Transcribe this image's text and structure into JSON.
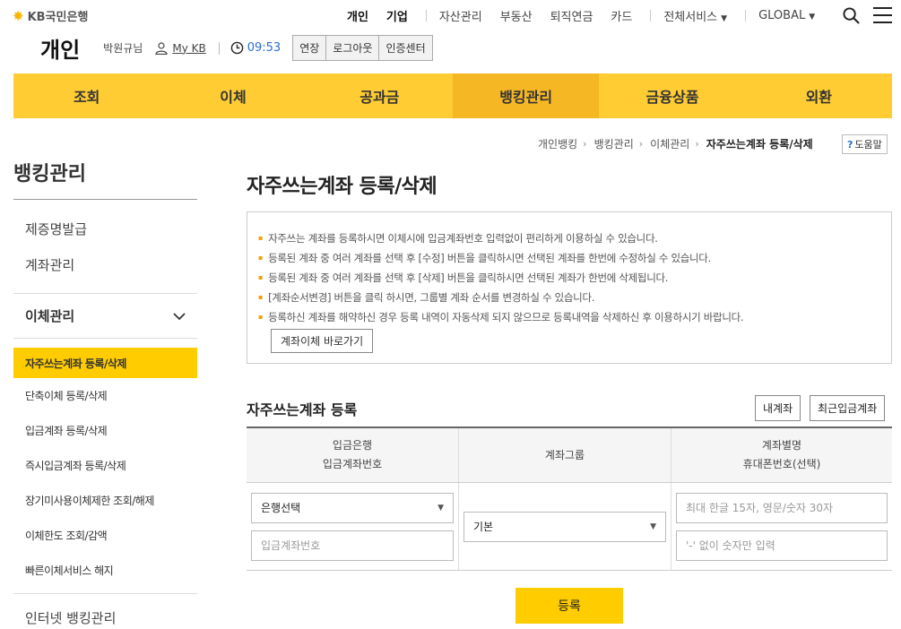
{
  "brand": {
    "logo_text": "KB국민은행"
  },
  "topnav": {
    "personal": "개인",
    "business": "기업",
    "asset": "자산관리",
    "realestate": "부동산",
    "pension": "퇴직연금",
    "card": "카드",
    "all_services": "전체서비스",
    "global": "GLOBAL"
  },
  "header": {
    "page_type": "개인",
    "user_name": "박원규님",
    "mykb": "My KB",
    "time": "09:53",
    "extend": "연장",
    "logout": "로그아웃",
    "cert_center": "인증센터"
  },
  "mainnav": {
    "tabs": [
      "조회",
      "이체",
      "공과금",
      "뱅킹관리",
      "금융상품",
      "외환"
    ],
    "active": "뱅킹관리"
  },
  "sidebar": {
    "title": "뱅킹관리",
    "items": [
      "제증명발급",
      "계좌관리"
    ],
    "group_label": "이체관리",
    "sub_items": [
      "자주쓰는계좌 등록/삭제",
      "단축이체 등록/삭제",
      "입금계좌 등록/삭제",
      "즉시입금계좌 등록/삭제",
      "장기미사용이체제한 조회/해제",
      "이체한도 조회/감액",
      "빠른이체서비스 해지"
    ],
    "last_item": "인터넷 뱅킹관리"
  },
  "breadcrumb": [
    "개인뱅킹",
    "뱅킹관리",
    "이체관리",
    "자주쓰는계좌 등록/삭제"
  ],
  "help": "도움말",
  "content": {
    "title": "자주쓰는계좌 등록/삭제",
    "notices": [
      "자주쓰는 계좌를 등록하시면 이체시에 입금계좌번호 입력없이 편리하게 이용하실 수 있습니다.",
      "등록된 계좌 중 여러 계좌를 선택 후 [수정] 버튼을 클릭하시면 선택된 계좌를 한번에 수정하실 수 있습니다.",
      "등록된 계좌 중 여러 계좌를 선택 후 [삭제] 버튼을 클릭하시면 선택된 계좌가 한번에 삭제됩니다.",
      "[계좌순서변경] 버튼을 클릭 하시면, 그룹별 계좌 순서를 변경하실 수 있습니다.",
      "등록하신 계좌를 해약하신 경우 등록 내역이 자동삭제 되지 않으므로 등록내역을 삭제하신 후 이용하시기 바랍니다."
    ],
    "go_transfer": "계좌이체 바로가기",
    "section_title": "자주쓰는계좌 등록",
    "my_account_btn": "내계좌",
    "recent_btn": "최근입금계좌",
    "table": {
      "h1a": "입금은행",
      "h1b": "입금계좌번호",
      "h2": "계좌그룹",
      "h3a": "계좌별명",
      "h3b": "휴대폰번호(선택)",
      "bank_select": "은행선택",
      "account_placeholder": "입금계좌번호",
      "group_select": "기본",
      "alias_placeholder": "최대 한글 15자, 영문/숫자 30자",
      "phone_placeholder": "'-' 없이 숫자만 입력"
    },
    "register": "등록"
  }
}
